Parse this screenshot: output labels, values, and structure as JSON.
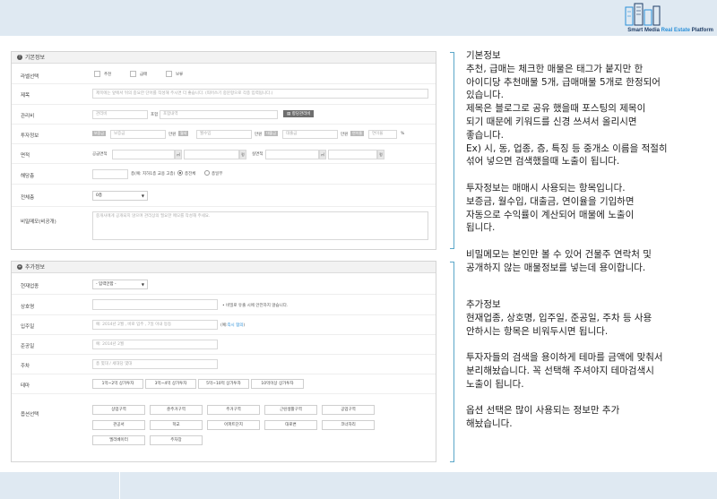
{
  "brand": {
    "name_prefix": "Smart Media ",
    "name_accent": "Real Estate",
    "name_suffix": " Platform"
  },
  "basic": {
    "title": "기본정보",
    "label_select": {
      "label": "라벨선택",
      "options": [
        "추천",
        "급매",
        "보류"
      ]
    },
    "title_field": {
      "label": "제목",
      "placeholder": "제목에는 앞에서 뒤의 중요한 단어를 작성해 주시면 더 좋습니다. (띄어쓰기 중문항으로 각종 입력됩니다.)"
    },
    "mgmt_fee": {
      "label": "관리비",
      "ph_fee": "관리비",
      "label_incl": "포함",
      "ph_incl": "포함내역",
      "btn": "항당관리비"
    },
    "invest": {
      "label": "투자정보",
      "items": [
        {
          "tag": "보증금",
          "ph": "보증금",
          "unit": "만원"
        },
        {
          "tag": "월세",
          "ph": "월수입",
          "unit": "만원"
        },
        {
          "tag": "대출금",
          "ph": "대출금",
          "unit": "만원"
        },
        {
          "tag": "연이율",
          "ph": "연이율",
          "unit": "%"
        }
      ]
    },
    "area": {
      "label": "면적",
      "supply": "공급면적",
      "actual": "실면적",
      "unit_m2": "㎡",
      "unit_py": "평"
    },
    "floor": {
      "label": "해당층",
      "note": "층(예: 지하1층 교용 고층)",
      "options": [
        "층전체",
        "층일부"
      ]
    },
    "total_floor": {
      "label": "전체층",
      "value": "0층"
    },
    "memo": {
      "label": "비밀메모(비공개)",
      "placeholder": "중개사에게 공개되지 않으며 관리상의 필요한 메모를 작성해 주세요."
    }
  },
  "extra": {
    "title": "추가정보",
    "business": {
      "label": "현재업종",
      "value": "- 입력안함 -"
    },
    "shop_name": {
      "label": "상호명",
      "note": "• 비밀로 유출 시에 안전하지 않습니다."
    },
    "move_in": {
      "label": "입주일",
      "placeholder": "예: 2014년 2월 , 바로 입주 , 7일 이내 등등",
      "note_pre": "(예:",
      "note_link": "즉시 협의",
      "note_post": ")"
    },
    "completion": {
      "label": "준공일",
      "placeholder": "예: 2014년 2월"
    },
    "parking": {
      "label": "주차",
      "placeholder": "총 몇대 / 세대당 몇대"
    },
    "theme": {
      "label": "테마",
      "buttons": [
        "1억~2억 상가투자",
        "3억~4억 상가투자",
        "5억~10억 상가투자",
        "10억이상 상가투자"
      ]
    },
    "options": {
      "label": "옵션선택",
      "row1": [
        "상업구역",
        "준주거구역",
        "주거구역",
        "근린생활구역",
        "공업구역"
      ],
      "row2": [
        "관공서",
        "학교",
        "아파트단지",
        "대로변",
        "코너자리"
      ],
      "row3": [
        "엘리베이터",
        "주차장"
      ]
    }
  },
  "notes": {
    "section1": "기본정보\n추천, 급매는 체크한 매물은 태그가 붙지만 한\n아이디당 추천매물 5개, 급매매물 5개로 한정되어\n있습니다.\n제목은 블로그로 공유 했을때 포스팅의 제목이\n되기 때문에 키워드를 신경 쓰셔서 올리시면\n좋습니다.\nEx) 시, 동, 업종, 층, 특징 등 중개소 이름을 적절히\n섞어 넣으면 검색했을때 노출이 됩니다.",
    "section2": "투자정보는 매매시 사용되는 항목입니다.\n보증금, 월수입, 대출금, 연이율을 기입하면\n자동으로 수익률이 계산되어 매물에 노출이\n됩니다.",
    "section3": "비밀메모는 본인만 볼 수 있어 건물주 연락처 및\n공개하지 않는 매물정보를 넣는데 용이합니다.",
    "section4": "추가정보\n현재업종, 상호명, 입주일, 준공일, 주차 등 사용\n안하시는 항목은 비워두시면 됩니다.",
    "section5": "투자자들의 검색을 용이하게 테마를 금액에 맞춰서\n분리해놨습니다. 꼭 선택해 주셔야지 테마검색시\n노출이 됩니다.",
    "section6": "옵션 선택은 많이 사용되는 정보만 추가\n해놨습니다."
  },
  "colors": {
    "accent": "#2a8fd8",
    "bar": "#dfe9f2",
    "bracket": "#5aa6c8"
  }
}
